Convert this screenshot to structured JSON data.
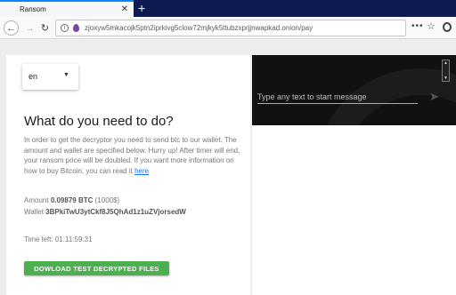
{
  "browser": {
    "tab_title": "Ransom",
    "tab_close": "✕",
    "new_tab": "+",
    "url": "zjoxyw5mkacojk5ptn2iprkivg5clow72mjkyk5ttubzxprjjnwapkad.onion/pay",
    "icons": {
      "back": "back-arrow-icon",
      "forward": "forward-arrow-icon",
      "reload": "reload-icon",
      "info": "info-icon",
      "onion": "onion-icon",
      "more": "more-icon",
      "star": "star-icon",
      "extension": "extension-icon"
    }
  },
  "page": {
    "language": "en",
    "heading": "What do you need to do?",
    "instructions": "In order to get the decryptor you need to send btc to our wallet. The amount and wallet are specified below. Hurry up! After timer will end, your ransom price will be doubled. If you want more information on how to buy Bitcoin, you can read it",
    "link_text": "here",
    "amount_label": "Amount",
    "amount_btc": "0.09879 BTC",
    "amount_usd": "(1000$)",
    "wallet_label": "Wallet",
    "wallet_address": "3BPkiTwU3ytCkf8J5QhAd1z1uZVjorsedW",
    "time_left_label": "Time left:",
    "time_left": "01:11:59:31",
    "download_button": "DOWLOAD TEST DECRYPTED FILES"
  },
  "chat": {
    "placeholder": "Type any text to start message"
  },
  "colors": {
    "accent_button": "#4caf50",
    "titlebar": "#0c1a4f",
    "link": "#1a73e8"
  }
}
